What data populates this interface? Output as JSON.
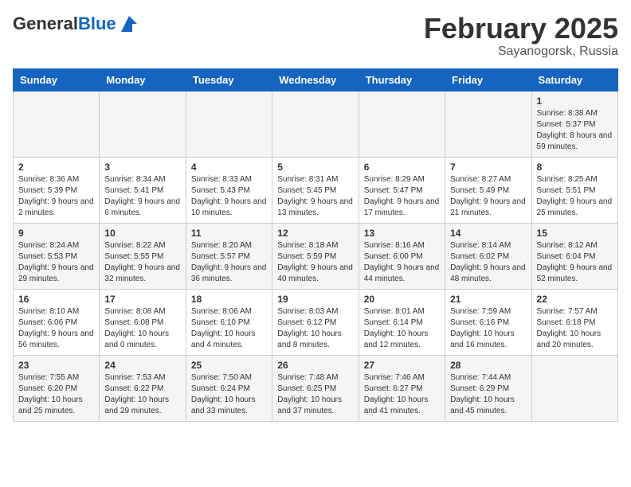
{
  "header": {
    "logo_general": "General",
    "logo_blue": "Blue",
    "month_year": "February 2025",
    "location": "Sayanogorsk, Russia"
  },
  "days_of_week": [
    "Sunday",
    "Monday",
    "Tuesday",
    "Wednesday",
    "Thursday",
    "Friday",
    "Saturday"
  ],
  "weeks": [
    [
      {
        "day": "",
        "info": ""
      },
      {
        "day": "",
        "info": ""
      },
      {
        "day": "",
        "info": ""
      },
      {
        "day": "",
        "info": ""
      },
      {
        "day": "",
        "info": ""
      },
      {
        "day": "",
        "info": ""
      },
      {
        "day": "1",
        "info": "Sunrise: 8:38 AM\nSunset: 5:37 PM\nDaylight: 8 hours and 59 minutes."
      }
    ],
    [
      {
        "day": "2",
        "info": "Sunrise: 8:36 AM\nSunset: 5:39 PM\nDaylight: 9 hours and 2 minutes."
      },
      {
        "day": "3",
        "info": "Sunrise: 8:34 AM\nSunset: 5:41 PM\nDaylight: 9 hours and 6 minutes."
      },
      {
        "day": "4",
        "info": "Sunrise: 8:33 AM\nSunset: 5:43 PM\nDaylight: 9 hours and 10 minutes."
      },
      {
        "day": "5",
        "info": "Sunrise: 8:31 AM\nSunset: 5:45 PM\nDaylight: 9 hours and 13 minutes."
      },
      {
        "day": "6",
        "info": "Sunrise: 8:29 AM\nSunset: 5:47 PM\nDaylight: 9 hours and 17 minutes."
      },
      {
        "day": "7",
        "info": "Sunrise: 8:27 AM\nSunset: 5:49 PM\nDaylight: 9 hours and 21 minutes."
      },
      {
        "day": "8",
        "info": "Sunrise: 8:25 AM\nSunset: 5:51 PM\nDaylight: 9 hours and 25 minutes."
      }
    ],
    [
      {
        "day": "9",
        "info": "Sunrise: 8:24 AM\nSunset: 5:53 PM\nDaylight: 9 hours and 29 minutes."
      },
      {
        "day": "10",
        "info": "Sunrise: 8:22 AM\nSunset: 5:55 PM\nDaylight: 9 hours and 32 minutes."
      },
      {
        "day": "11",
        "info": "Sunrise: 8:20 AM\nSunset: 5:57 PM\nDaylight: 9 hours and 36 minutes."
      },
      {
        "day": "12",
        "info": "Sunrise: 8:18 AM\nSunset: 5:59 PM\nDaylight: 9 hours and 40 minutes."
      },
      {
        "day": "13",
        "info": "Sunrise: 8:16 AM\nSunset: 6:00 PM\nDaylight: 9 hours and 44 minutes."
      },
      {
        "day": "14",
        "info": "Sunrise: 8:14 AM\nSunset: 6:02 PM\nDaylight: 9 hours and 48 minutes."
      },
      {
        "day": "15",
        "info": "Sunrise: 8:12 AM\nSunset: 6:04 PM\nDaylight: 9 hours and 52 minutes."
      }
    ],
    [
      {
        "day": "16",
        "info": "Sunrise: 8:10 AM\nSunset: 6:06 PM\nDaylight: 9 hours and 56 minutes."
      },
      {
        "day": "17",
        "info": "Sunrise: 8:08 AM\nSunset: 6:08 PM\nDaylight: 10 hours and 0 minutes."
      },
      {
        "day": "18",
        "info": "Sunrise: 8:06 AM\nSunset: 6:10 PM\nDaylight: 10 hours and 4 minutes."
      },
      {
        "day": "19",
        "info": "Sunrise: 8:03 AM\nSunset: 6:12 PM\nDaylight: 10 hours and 8 minutes."
      },
      {
        "day": "20",
        "info": "Sunrise: 8:01 AM\nSunset: 6:14 PM\nDaylight: 10 hours and 12 minutes."
      },
      {
        "day": "21",
        "info": "Sunrise: 7:59 AM\nSunset: 6:16 PM\nDaylight: 10 hours and 16 minutes."
      },
      {
        "day": "22",
        "info": "Sunrise: 7:57 AM\nSunset: 6:18 PM\nDaylight: 10 hours and 20 minutes."
      }
    ],
    [
      {
        "day": "23",
        "info": "Sunrise: 7:55 AM\nSunset: 6:20 PM\nDaylight: 10 hours and 25 minutes."
      },
      {
        "day": "24",
        "info": "Sunrise: 7:53 AM\nSunset: 6:22 PM\nDaylight: 10 hours and 29 minutes."
      },
      {
        "day": "25",
        "info": "Sunrise: 7:50 AM\nSunset: 6:24 PM\nDaylight: 10 hours and 33 minutes."
      },
      {
        "day": "26",
        "info": "Sunrise: 7:48 AM\nSunset: 6:25 PM\nDaylight: 10 hours and 37 minutes."
      },
      {
        "day": "27",
        "info": "Sunrise: 7:46 AM\nSunset: 6:27 PM\nDaylight: 10 hours and 41 minutes."
      },
      {
        "day": "28",
        "info": "Sunrise: 7:44 AM\nSunset: 6:29 PM\nDaylight: 10 hours and 45 minutes."
      },
      {
        "day": "",
        "info": ""
      }
    ]
  ]
}
